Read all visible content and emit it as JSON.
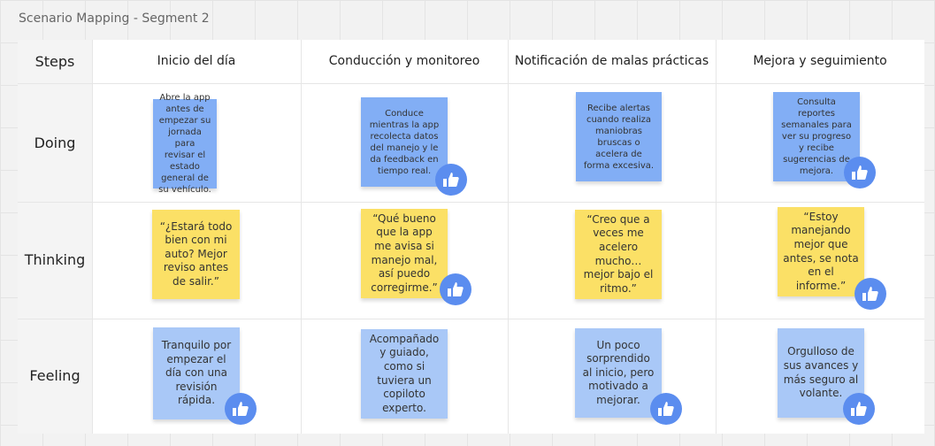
{
  "board_title": "Scenario Mapping - Segment 2",
  "steps_label": "Steps",
  "rows": [
    "Doing",
    "Thinking",
    "Feeling"
  ],
  "columns": [
    "Inicio del día",
    "Conducción y monitoreo",
    "Notificación de malas prácticas",
    "Mejora y seguimiento"
  ],
  "doing": [
    "Abre la app antes de empezar su jornada para revisar el estado general de su vehículo.",
    "Conduce mientras la app recolecta datos del manejo y le da feedback en tiempo real.",
    "Recibe alertas cuando realiza maniobras bruscas o acelera de forma excesiva.",
    "Consulta reportes semanales para ver su progreso y recibe sugerencias de mejora."
  ],
  "thinking": [
    "“¿Estará todo bien con mi auto? Mejor reviso antes de salir.”",
    "“Qué bueno que la app me avisa si manejo mal, así puedo corregirme.”",
    "“Creo que a veces me acelero mucho… mejor bajo el ritmo.”",
    "“Estoy manejando mejor que antes, se nota en el informe.”"
  ],
  "feeling": [
    "Tranquilo por empezar el día con una revisión rápida.",
    "Acompañado y guiado, como si tuviera un copiloto experto.",
    "Un poco sorprendido al inicio, pero motivado a mejorar.",
    "Orgulloso de sus avances y más seguro al volante."
  ],
  "colors": {
    "doing": "#82aef5",
    "thinking": "#fbe066",
    "feeling": "#a9c8f7",
    "thumb": "#5b8def"
  },
  "icons": {
    "reaction": "thumbs-up-icon"
  }
}
